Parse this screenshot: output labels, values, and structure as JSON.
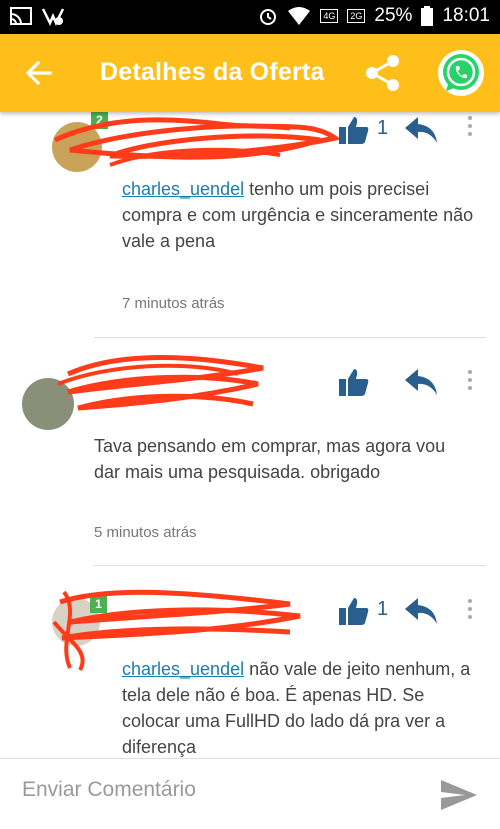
{
  "status_bar": {
    "battery": "25%",
    "time": "18:01",
    "net1": "4G",
    "net2": "2G"
  },
  "app_bar": {
    "title": "Detalhes da Oferta"
  },
  "comments": [
    {
      "badge": "2",
      "mention": "charles_uendel",
      "text": " tenho um pois precisei compra e com urgência e sinceramente não vale a pena",
      "time": "7 minutos atrás",
      "likes": "1"
    },
    {
      "badge": "",
      "mention": "",
      "text": "Tava pensando em comprar, mas agora vou dar mais uma pesquisada. obrigado",
      "time": "5 minutos atrás",
      "likes": ""
    },
    {
      "badge": "1",
      "mention": "charles_uendel",
      "text": " não vale de jeito nenhum, a tela dele não é boa. É apenas HD. Se colocar uma FullHD do lado dá pra ver a diferença",
      "time": "",
      "likes": "1"
    }
  ],
  "composer": {
    "placeholder": "Enviar Comentário"
  },
  "colors": {
    "app_bar": "#ffbf1a",
    "like": "#2a5e8f",
    "mention": "#1a7fa8",
    "whatsapp": "#25d366"
  },
  "icons": [
    "back-arrow-icon",
    "share-icon",
    "whatsapp-icon",
    "thumbs-up-icon",
    "reply-icon",
    "more-vert-icon",
    "send-icon"
  ]
}
